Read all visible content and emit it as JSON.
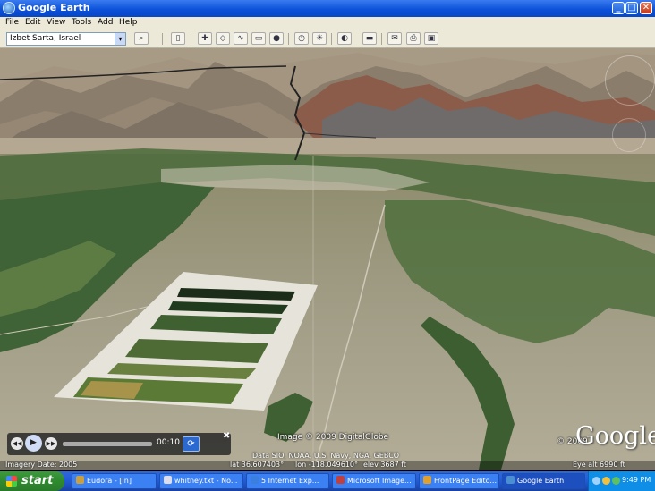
{
  "window": {
    "title": "Google Earth",
    "minimize": "_",
    "maximize": "□",
    "close": "✕"
  },
  "menu": [
    "File",
    "Edit",
    "View",
    "Tools",
    "Add",
    "Help"
  ],
  "search": {
    "value": "Izbet Sarta, Israel",
    "dropdown": "▾"
  },
  "toolbar_icons": [
    "search-icon",
    "sidebar-icon",
    "placemark-icon",
    "polygon-icon",
    "path-icon",
    "image-overlay-icon",
    "record-tour-icon",
    "historical-imagery-icon",
    "sunlight-icon",
    "planets-icon",
    "ruler-icon",
    "email-icon",
    "print-icon",
    "save-image-icon"
  ],
  "view": {
    "attribution": "Image © 2009 DigitalGlobe",
    "copyright": "© 2009",
    "logo": "Google"
  },
  "tour_player": {
    "rewind": "◀◀",
    "play": "▶",
    "forward": "▶▶",
    "time": "00:10",
    "loop": "⟳",
    "close": "✖",
    "progress": 0.02
  },
  "status": {
    "imagery_date": "Imagery Date: 2005",
    "data": "Data SIO, NOAA, U.S. Navy, NGA, GEBCO",
    "lat": "lat  36.607403°",
    "lon": "lon -118.049610°",
    "elev": "elev  3687 ft",
    "eye_alt": "Eye alt  6990 ft"
  },
  "taskbar": {
    "start": "start",
    "tasks": [
      {
        "label": "Eudora - [In]",
        "color": "#c8a040"
      },
      {
        "label": "whitney.txt - No...",
        "color": "#dde"
      },
      {
        "label": "5 Internet Exp...",
        "color": "#3a7ee0"
      },
      {
        "label": "Microsoft Image...",
        "color": "#c04040"
      },
      {
        "label": "FrontPage Edito...",
        "color": "#e0a030"
      },
      {
        "label": "Google Earth",
        "color": "#4a90d0"
      }
    ],
    "clock": "9:49 PM"
  }
}
